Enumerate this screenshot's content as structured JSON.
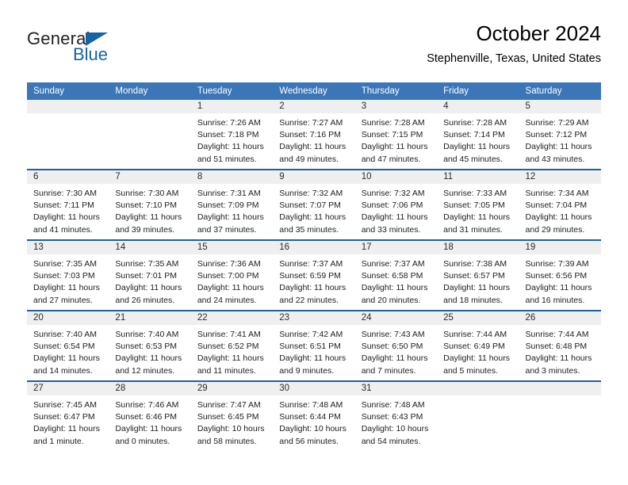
{
  "brand": {
    "name_part1": "General",
    "name_part2": "Blue",
    "logo_icon": "triangle-logo-icon"
  },
  "header": {
    "title": "October 2024",
    "subtitle": "Stephenville, Texas, United States"
  },
  "colors": {
    "header_blue": "#3b76b8",
    "rule_blue": "#1f5ea8",
    "brand_blue": "#1464a5",
    "daynum_band": "#efefef"
  },
  "weekday_headers": [
    "Sunday",
    "Monday",
    "Tuesday",
    "Wednesday",
    "Thursday",
    "Friday",
    "Saturday"
  ],
  "labels": {
    "sunrise_prefix": "Sunrise:",
    "sunset_prefix": "Sunset:",
    "daylight_prefix": "Daylight:"
  },
  "weeks": [
    [
      {
        "day": "",
        "empty": true
      },
      {
        "day": "",
        "empty": true
      },
      {
        "day": "1",
        "sunrise": "Sunrise: 7:26 AM",
        "sunset": "Sunset: 7:18 PM",
        "daylight_l1": "Daylight: 11 hours",
        "daylight_l2": "and 51 minutes."
      },
      {
        "day": "2",
        "sunrise": "Sunrise: 7:27 AM",
        "sunset": "Sunset: 7:16 PM",
        "daylight_l1": "Daylight: 11 hours",
        "daylight_l2": "and 49 minutes."
      },
      {
        "day": "3",
        "sunrise": "Sunrise: 7:28 AM",
        "sunset": "Sunset: 7:15 PM",
        "daylight_l1": "Daylight: 11 hours",
        "daylight_l2": "and 47 minutes."
      },
      {
        "day": "4",
        "sunrise": "Sunrise: 7:28 AM",
        "sunset": "Sunset: 7:14 PM",
        "daylight_l1": "Daylight: 11 hours",
        "daylight_l2": "and 45 minutes."
      },
      {
        "day": "5",
        "sunrise": "Sunrise: 7:29 AM",
        "sunset": "Sunset: 7:12 PM",
        "daylight_l1": "Daylight: 11 hours",
        "daylight_l2": "and 43 minutes."
      }
    ],
    [
      {
        "day": "6",
        "sunrise": "Sunrise: 7:30 AM",
        "sunset": "Sunset: 7:11 PM",
        "daylight_l1": "Daylight: 11 hours",
        "daylight_l2": "and 41 minutes."
      },
      {
        "day": "7",
        "sunrise": "Sunrise: 7:30 AM",
        "sunset": "Sunset: 7:10 PM",
        "daylight_l1": "Daylight: 11 hours",
        "daylight_l2": "and 39 minutes."
      },
      {
        "day": "8",
        "sunrise": "Sunrise: 7:31 AM",
        "sunset": "Sunset: 7:09 PM",
        "daylight_l1": "Daylight: 11 hours",
        "daylight_l2": "and 37 minutes."
      },
      {
        "day": "9",
        "sunrise": "Sunrise: 7:32 AM",
        "sunset": "Sunset: 7:07 PM",
        "daylight_l1": "Daylight: 11 hours",
        "daylight_l2": "and 35 minutes."
      },
      {
        "day": "10",
        "sunrise": "Sunrise: 7:32 AM",
        "sunset": "Sunset: 7:06 PM",
        "daylight_l1": "Daylight: 11 hours",
        "daylight_l2": "and 33 minutes."
      },
      {
        "day": "11",
        "sunrise": "Sunrise: 7:33 AM",
        "sunset": "Sunset: 7:05 PM",
        "daylight_l1": "Daylight: 11 hours",
        "daylight_l2": "and 31 minutes."
      },
      {
        "day": "12",
        "sunrise": "Sunrise: 7:34 AM",
        "sunset": "Sunset: 7:04 PM",
        "daylight_l1": "Daylight: 11 hours",
        "daylight_l2": "and 29 minutes."
      }
    ],
    [
      {
        "day": "13",
        "sunrise": "Sunrise: 7:35 AM",
        "sunset": "Sunset: 7:03 PM",
        "daylight_l1": "Daylight: 11 hours",
        "daylight_l2": "and 27 minutes."
      },
      {
        "day": "14",
        "sunrise": "Sunrise: 7:35 AM",
        "sunset": "Sunset: 7:01 PM",
        "daylight_l1": "Daylight: 11 hours",
        "daylight_l2": "and 26 minutes."
      },
      {
        "day": "15",
        "sunrise": "Sunrise: 7:36 AM",
        "sunset": "Sunset: 7:00 PM",
        "daylight_l1": "Daylight: 11 hours",
        "daylight_l2": "and 24 minutes."
      },
      {
        "day": "16",
        "sunrise": "Sunrise: 7:37 AM",
        "sunset": "Sunset: 6:59 PM",
        "daylight_l1": "Daylight: 11 hours",
        "daylight_l2": "and 22 minutes."
      },
      {
        "day": "17",
        "sunrise": "Sunrise: 7:37 AM",
        "sunset": "Sunset: 6:58 PM",
        "daylight_l1": "Daylight: 11 hours",
        "daylight_l2": "and 20 minutes."
      },
      {
        "day": "18",
        "sunrise": "Sunrise: 7:38 AM",
        "sunset": "Sunset: 6:57 PM",
        "daylight_l1": "Daylight: 11 hours",
        "daylight_l2": "and 18 minutes."
      },
      {
        "day": "19",
        "sunrise": "Sunrise: 7:39 AM",
        "sunset": "Sunset: 6:56 PM",
        "daylight_l1": "Daylight: 11 hours",
        "daylight_l2": "and 16 minutes."
      }
    ],
    [
      {
        "day": "20",
        "sunrise": "Sunrise: 7:40 AM",
        "sunset": "Sunset: 6:54 PM",
        "daylight_l1": "Daylight: 11 hours",
        "daylight_l2": "and 14 minutes."
      },
      {
        "day": "21",
        "sunrise": "Sunrise: 7:40 AM",
        "sunset": "Sunset: 6:53 PM",
        "daylight_l1": "Daylight: 11 hours",
        "daylight_l2": "and 12 minutes."
      },
      {
        "day": "22",
        "sunrise": "Sunrise: 7:41 AM",
        "sunset": "Sunset: 6:52 PM",
        "daylight_l1": "Daylight: 11 hours",
        "daylight_l2": "and 11 minutes."
      },
      {
        "day": "23",
        "sunrise": "Sunrise: 7:42 AM",
        "sunset": "Sunset: 6:51 PM",
        "daylight_l1": "Daylight: 11 hours",
        "daylight_l2": "and 9 minutes."
      },
      {
        "day": "24",
        "sunrise": "Sunrise: 7:43 AM",
        "sunset": "Sunset: 6:50 PM",
        "daylight_l1": "Daylight: 11 hours",
        "daylight_l2": "and 7 minutes."
      },
      {
        "day": "25",
        "sunrise": "Sunrise: 7:44 AM",
        "sunset": "Sunset: 6:49 PM",
        "daylight_l1": "Daylight: 11 hours",
        "daylight_l2": "and 5 minutes."
      },
      {
        "day": "26",
        "sunrise": "Sunrise: 7:44 AM",
        "sunset": "Sunset: 6:48 PM",
        "daylight_l1": "Daylight: 11 hours",
        "daylight_l2": "and 3 minutes."
      }
    ],
    [
      {
        "day": "27",
        "sunrise": "Sunrise: 7:45 AM",
        "sunset": "Sunset: 6:47 PM",
        "daylight_l1": "Daylight: 11 hours",
        "daylight_l2": "and 1 minute."
      },
      {
        "day": "28",
        "sunrise": "Sunrise: 7:46 AM",
        "sunset": "Sunset: 6:46 PM",
        "daylight_l1": "Daylight: 11 hours",
        "daylight_l2": "and 0 minutes."
      },
      {
        "day": "29",
        "sunrise": "Sunrise: 7:47 AM",
        "sunset": "Sunset: 6:45 PM",
        "daylight_l1": "Daylight: 10 hours",
        "daylight_l2": "and 58 minutes."
      },
      {
        "day": "30",
        "sunrise": "Sunrise: 7:48 AM",
        "sunset": "Sunset: 6:44 PM",
        "daylight_l1": "Daylight: 10 hours",
        "daylight_l2": "and 56 minutes."
      },
      {
        "day": "31",
        "sunrise": "Sunrise: 7:48 AM",
        "sunset": "Sunset: 6:43 PM",
        "daylight_l1": "Daylight: 10 hours",
        "daylight_l2": "and 54 minutes."
      },
      {
        "day": "",
        "empty": true
      },
      {
        "day": "",
        "empty": true
      }
    ]
  ]
}
